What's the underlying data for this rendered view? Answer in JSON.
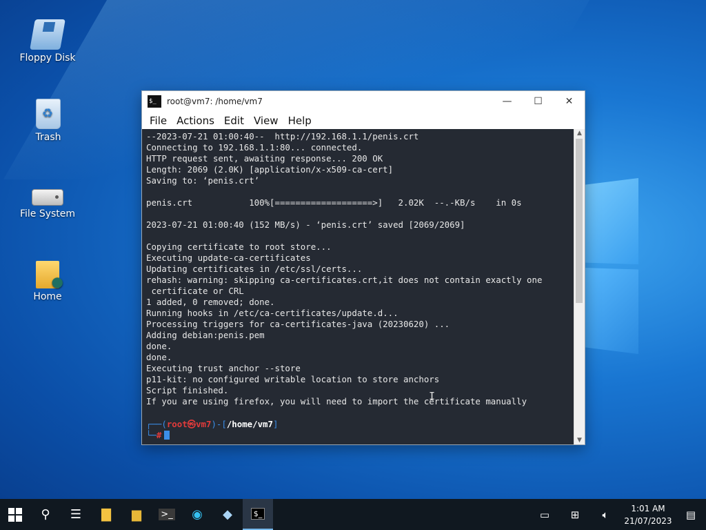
{
  "desktop": {
    "icons": [
      {
        "label": "Floppy Disk"
      },
      {
        "label": "Trash"
      },
      {
        "label": "File System"
      },
      {
        "label": "Home"
      }
    ]
  },
  "window": {
    "title": "root@vm7: /home/vm7",
    "app_icon_text": "$_",
    "controls": {
      "minimize": "—",
      "maximize": "☐",
      "close": "✕"
    },
    "menu": [
      "File",
      "Actions",
      "Edit",
      "View",
      "Help"
    ]
  },
  "terminal": {
    "output": "--2023-07-21 01:00:40--  http://192.168.1.1/penis.crt\nConnecting to 192.168.1.1:80... connected.\nHTTP request sent, awaiting response... 200 OK\nLength: 2069 (2.0K) [application/x-x509-ca-cert]\nSaving to: ‘penis.crt’\n\npenis.crt           100%[===================>]   2.02K  --.-KB/s    in 0s\n\n2023-07-21 01:00:40 (152 MB/s) - ‘penis.crt’ saved [2069/2069]\n\nCopying certificate to root store...\nExecuting update-ca-certificates\nUpdating certificates in /etc/ssl/certs...\nrehash: warning: skipping ca-certificates.crt,it does not contain exactly one\n certificate or CRL\n1 added, 0 removed; done.\nRunning hooks in /etc/ca-certificates/update.d...\nProcessing triggers for ca-certificates-java (20230620) ...\nAdding debian:penis.pem\ndone.\ndone.\nExecuting trust anchor --store\np11-kit: no configured writable location to store anchors\nScript finished.\nIf you are using firefox, you will need to import the certificate manually",
    "prompt": {
      "open": "┌──(",
      "user": "root㉿vm7",
      "mid": ")-[",
      "path": "/home/vm7",
      "close": "]",
      "line2": "└─",
      "hash": "#"
    }
  },
  "taskbar": {
    "clock_time": "1:01 AM",
    "clock_date": "21/07/2023"
  },
  "colors": {
    "terminal_bg": "#252a33",
    "prompt_blue": "#3b8ee8",
    "prompt_red": "#e23b3b",
    "taskbar_bg": "#101820"
  }
}
